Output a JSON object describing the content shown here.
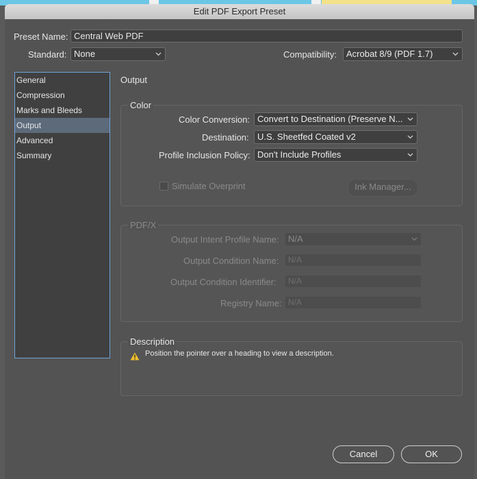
{
  "dialog": {
    "title": "Edit PDF Export Preset"
  },
  "preset": {
    "label": "Preset Name:",
    "value": "Central Web PDF"
  },
  "standard": {
    "label": "Standard:",
    "value": "None"
  },
  "compatibility": {
    "label": "Compatibility:",
    "value": "Acrobat 8/9 (PDF 1.7)"
  },
  "sidebar": {
    "items": [
      {
        "label": "General"
      },
      {
        "label": "Compression"
      },
      {
        "label": "Marks and Bleeds"
      },
      {
        "label": "Output",
        "selected": true
      },
      {
        "label": "Advanced"
      },
      {
        "label": "Summary"
      }
    ]
  },
  "main": {
    "heading": "Output"
  },
  "color": {
    "legend": "Color",
    "conversion": {
      "label": "Color Conversion:",
      "value": "Convert to Destination (Preserve N..."
    },
    "destination": {
      "label": "Destination:",
      "value": "U.S. Sheetfed Coated v2"
    },
    "profile_policy": {
      "label": "Profile Inclusion Policy:",
      "value": "Don't Include Profiles"
    },
    "simulate_overprint": {
      "label": "Simulate Overprint",
      "checked": false,
      "enabled": false
    },
    "ink_manager": {
      "label": "Ink Manager..."
    }
  },
  "pdfx": {
    "legend": "PDF/X",
    "intent_profile": {
      "label": "Output Intent Profile Name:",
      "value": "N/A"
    },
    "condition_name": {
      "label": "Output Condition Name:",
      "value": "N/A"
    },
    "condition_identifier": {
      "label": "Output Condition Identifier:",
      "value": "N/A"
    },
    "registry_name": {
      "label": "Registry Name:",
      "value": "N/A"
    }
  },
  "description": {
    "legend": "Description",
    "text": "Position the pointer over a heading to view a description."
  },
  "buttons": {
    "cancel": "Cancel",
    "ok": "OK"
  },
  "colors": {
    "accent": "#6fa3d8",
    "warning": "#f2c12e"
  }
}
